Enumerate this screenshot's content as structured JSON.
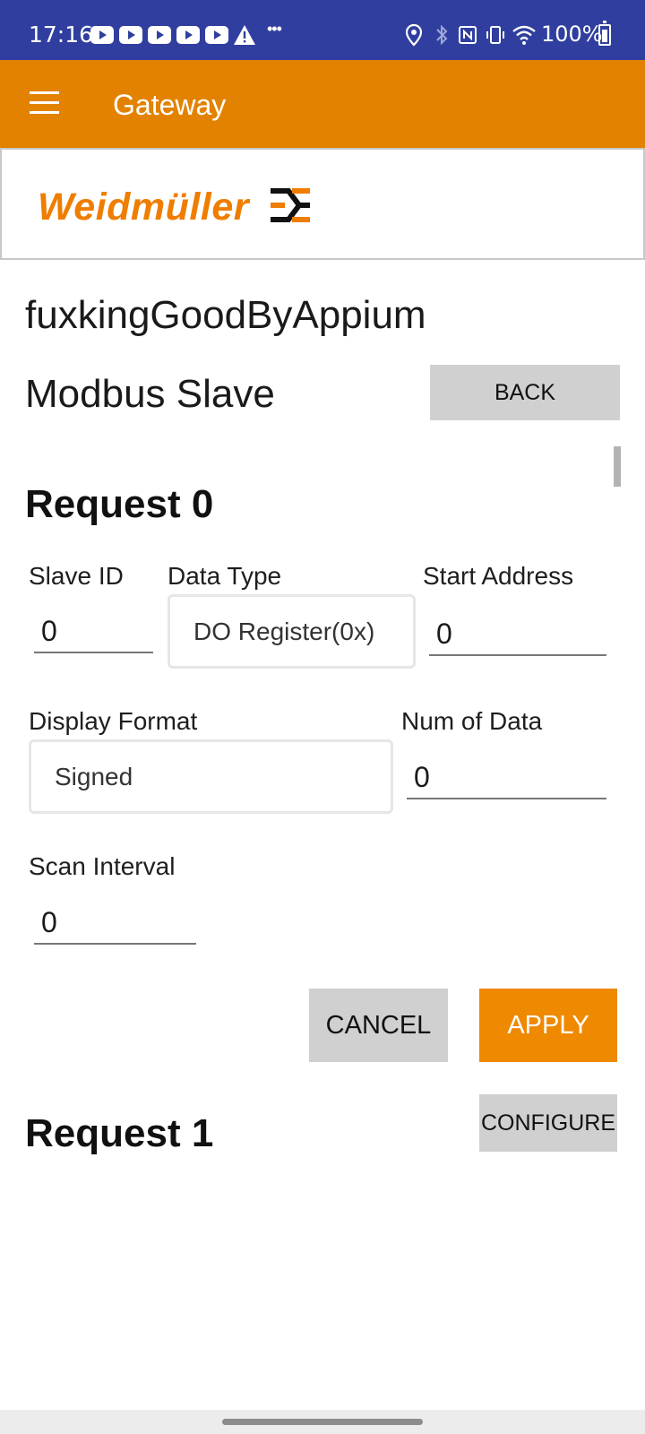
{
  "status_bar": {
    "time": "17:16",
    "notification_icons": [
      "youtube-icon",
      "youtube-icon",
      "youtube-icon",
      "youtube-icon",
      "youtube-icon",
      "warning-icon",
      "more-icon"
    ],
    "system_icons": [
      "location-icon",
      "bluetooth-icon",
      "nfc-icon",
      "vibrate-icon",
      "wifi-icon",
      "battery-icon"
    ],
    "battery": "100%"
  },
  "app_bar": {
    "title": "Gateway",
    "color": "#e38200"
  },
  "logo": {
    "text": "Weidmüller"
  },
  "page": {
    "gateway_name": "fuxkingGoodByAppium",
    "section_title": "Modbus Slave",
    "back_label": "BACK"
  },
  "requests": [
    {
      "title": "Request 0",
      "labels": {
        "slave_id": "Slave ID",
        "data_type": "Data Type",
        "start_address": "Start Address",
        "display_format": "Display Format",
        "num_of_data": "Num of Data",
        "scan_interval": "Scan Interval"
      },
      "values": {
        "slave_id": "0",
        "data_type": "DO Register(0x)",
        "start_address": "0",
        "display_format": "Signed",
        "num_of_data": "0",
        "scan_interval": "0"
      },
      "cancel_label": "CANCEL",
      "apply_label": "APPLY"
    },
    {
      "title": "Request 1",
      "configure_label": "CONFIGURE"
    }
  ],
  "colors": {
    "status_bar": "#303f9f",
    "accent": "#ef8900",
    "button_gray": "#d0d0d0"
  }
}
